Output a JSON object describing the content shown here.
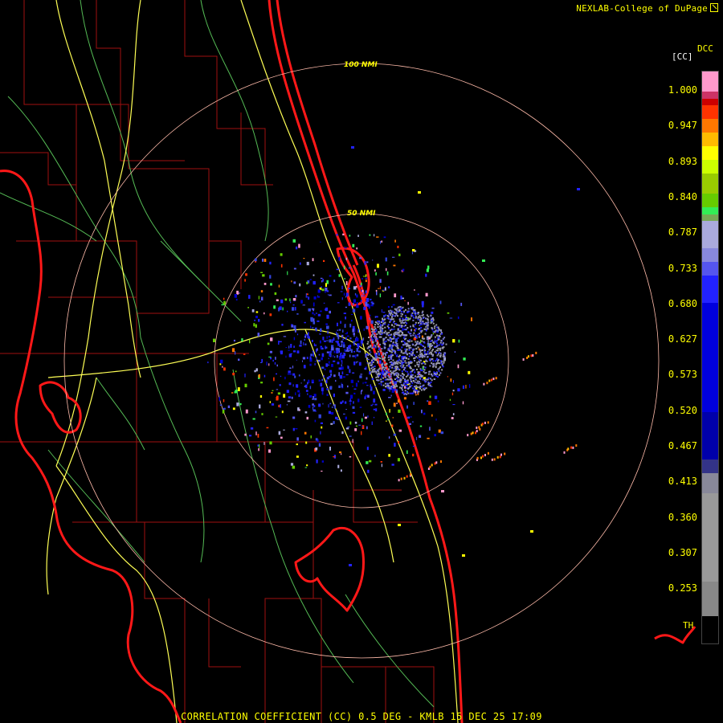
{
  "credit": "NEXLAB-College of DuPage",
  "caption": "CORRELATION COEFFICIENT (CC) 0.5 DEG - KMLB 15 DEC 25 17:09",
  "range_rings": [
    {
      "label": "50 NMI"
    },
    {
      "label": "100 NMI"
    }
  ],
  "legend": {
    "product": "DCC",
    "unit": "[CC]",
    "threshold_label": "TH",
    "ticks": [
      "1.000",
      "0.947",
      "0.893",
      "0.840",
      "0.787",
      "0.733",
      "0.680",
      "0.627",
      "0.573",
      "0.520",
      "0.467",
      "0.413",
      "0.360",
      "0.307",
      "0.253"
    ],
    "bands": [
      {
        "color": "#ff99cc",
        "from": 1.0
      },
      {
        "color": "#cc3366",
        "from": 0.97
      },
      {
        "color": "#cc0000",
        "from": 0.96
      },
      {
        "color": "#ff3300",
        "from": 0.95
      },
      {
        "color": "#ff7700",
        "from": 0.93
      },
      {
        "color": "#ffbb00",
        "from": 0.91
      },
      {
        "color": "#ffff00",
        "from": 0.89
      },
      {
        "color": "#ccff00",
        "from": 0.87
      },
      {
        "color": "#99cc00",
        "from": 0.85
      },
      {
        "color": "#66cc00",
        "from": 0.82
      },
      {
        "color": "#33ee55",
        "from": 0.8
      },
      {
        "color": "#77aa55",
        "from": 0.79
      },
      {
        "color": "#aaaadd",
        "from": 0.78
      },
      {
        "color": "#8888dd",
        "from": 0.74
      },
      {
        "color": "#5555ee",
        "from": 0.72
      },
      {
        "color": "#2222ff",
        "from": 0.7
      },
      {
        "color": "#0000dd",
        "from": 0.66
      },
      {
        "color": "#0000aa",
        "from": 0.5
      },
      {
        "color": "#333388",
        "from": 0.43
      },
      {
        "color": "#888899",
        "from": 0.41
      },
      {
        "color": "#999999",
        "from": 0.38
      },
      {
        "color": "#888888",
        "from": 0.25
      },
      {
        "color": "#000000",
        "from": 0.2
      }
    ]
  },
  "colors": {
    "coastline": "#ff1a1a",
    "county_lines": "#aa1111",
    "roads_primary": "#ffff66",
    "roads_secondary": "#66cc66",
    "range_ring": "#ffbbaa"
  }
}
